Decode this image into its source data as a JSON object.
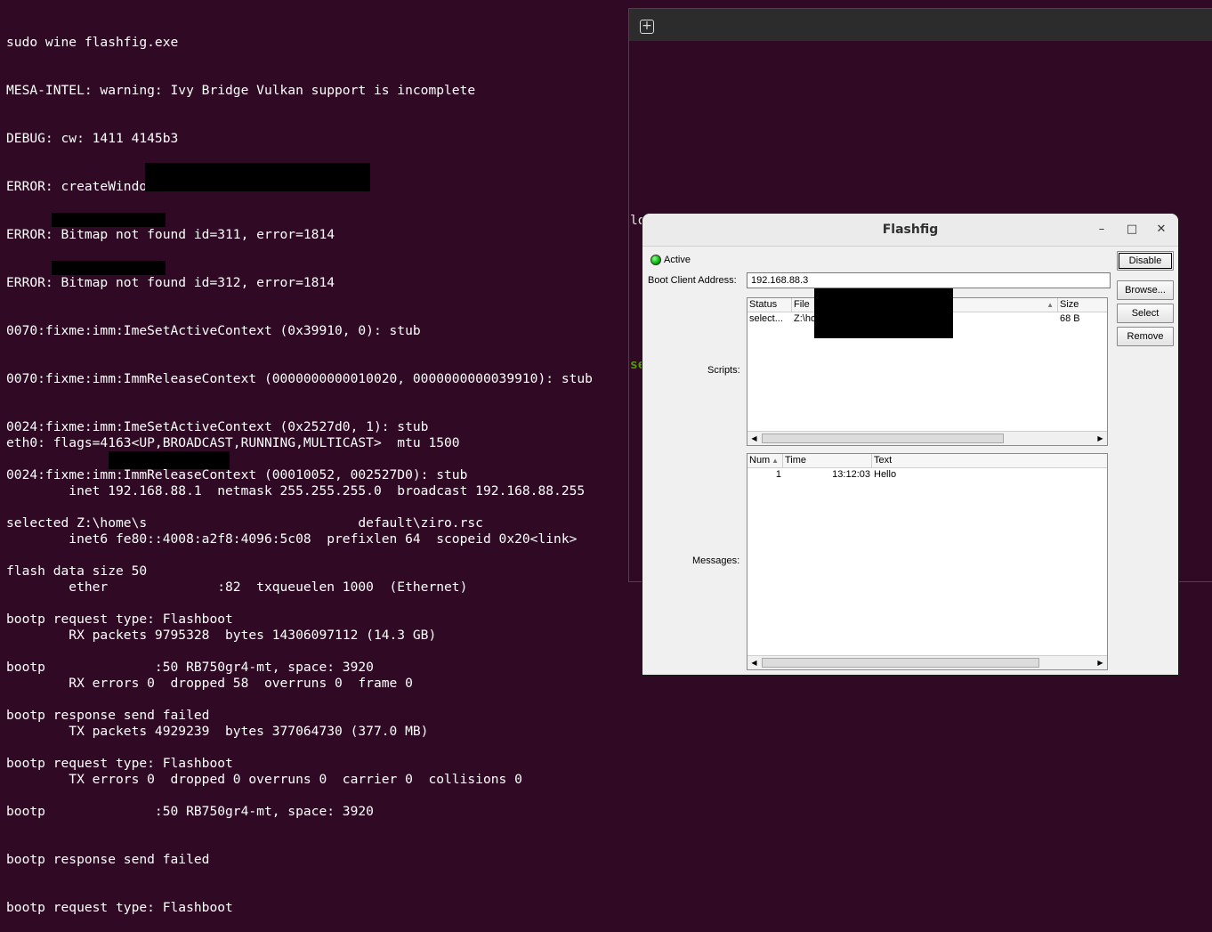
{
  "terminal": {
    "lines": [
      "sudo wine flashfig.exe",
      "MESA-INTEL: warning: Ivy Bridge Vulkan support is incomplete",
      "DEBUG: cw: 1411 4145b3",
      "ERROR: createWindow failed error=1411",
      "ERROR: Bitmap not found id=311, error=1814",
      "ERROR: Bitmap not found id=312, error=1814",
      "0070:fixme:imm:ImeSetActiveContext (0x39910, 0): stub",
      "0070:fixme:imm:ImmReleaseContext (0000000000010020, 0000000000039910): stub",
      "0024:fixme:imm:ImeSetActiveContext (0x2527d0, 1): stub",
      "0024:fixme:imm:ImmReleaseContext (00010052, 002527D0): stub",
      "selected Z:\\home\\s                           default\\ziro.rsc",
      "flash data size 50",
      "bootp request type: Flashboot",
      "bootp              :50 RB750gr4-mt, space: 3920",
      "bootp response send failed",
      "bootp request type: Flashboot",
      "bootp              :50 RB750gr4-mt, space: 3920",
      "bootp response send failed",
      "bootp request type: Flashboot"
    ],
    "ifconfig": [
      "eth0: flags=4163<UP,BROADCAST,RUNNING,MULTICAST>  mtu 1500",
      "        inet 192.168.88.1  netmask 255.255.255.0  broadcast 192.168.88.255",
      "        inet6 fe80::4008:a2f8:4096:5c08  prefixlen 64  scopeid 0x20<link>",
      "        ether              :82  txqueuelen 1000  (Ethernet)",
      "        RX packets 9795328  bytes 14306097112 (14.3 GB)",
      "        RX errors 0  dropped 58  overruns 0  frame 0",
      "        TX packets 4929239  bytes 377064730 (377.0 MB)",
      "        TX errors 0  dropped 0 overruns 0  carrier 0  collisions 0"
    ]
  },
  "second_pane": {
    "fragment_1": "lo",
    "fragment_2": "se"
  },
  "flashfig": {
    "title": "Flashfig",
    "status_label": "Active",
    "boot_client_label": "Boot Client Address:",
    "boot_client_value": "192.168.88.3",
    "buttons": {
      "disable": "Disable",
      "browse": "Browse...",
      "select": "Select",
      "remove": "Remove"
    },
    "scripts_label": "Scripts:",
    "scripts_columns": [
      "Status",
      "File",
      "Size"
    ],
    "scripts_rows": [
      {
        "status": "select...",
        "file": "Z:\\ho                              default\\ziro.rsc",
        "size": "68 B"
      }
    ],
    "messages_label": "Messages:",
    "messages_columns": [
      "Num",
      "Time",
      "Text"
    ],
    "messages_rows": [
      {
        "num": "1",
        "time": "13:12:03",
        "text": "Hello"
      }
    ]
  }
}
